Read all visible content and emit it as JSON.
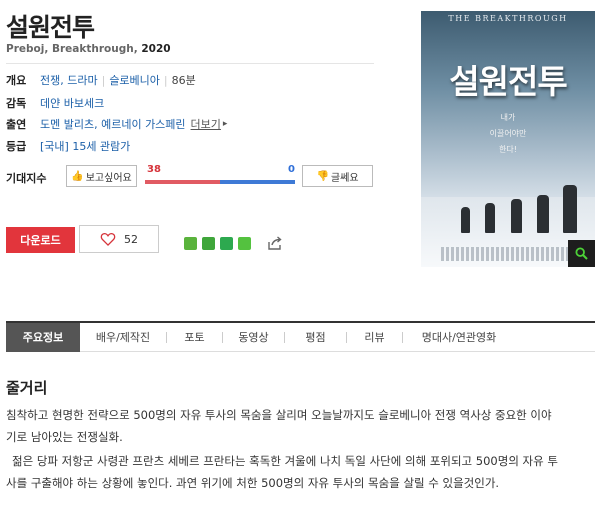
{
  "movie": {
    "title": "설원전투",
    "original_title": "Preboj, Breakthrough,",
    "year": "2020"
  },
  "info": {
    "overview": {
      "label": "개요",
      "genre": "전쟁, 드라마",
      "country": "슬로베니아",
      "runtime": "86분"
    },
    "director": {
      "label": "감독",
      "value": "데얀 바보세크"
    },
    "cast": {
      "label": "출연",
      "value": "도멘 발리츠, 예르네이 가스페린",
      "more": "더보기"
    },
    "rating": {
      "label": "등급",
      "value": "[국내] 15세 관람가"
    }
  },
  "expectation": {
    "label": "기대지수",
    "want_label": "보고싶어요",
    "want_count": "38",
    "notwant_label": "글쎄요",
    "notwant_count": "0",
    "want_ratio": 0.5
  },
  "actions": {
    "download_label": "다운로드",
    "like_count": "52"
  },
  "sns": [
    {
      "name": "blog-icon",
      "color": "#5ab33c"
    },
    {
      "name": "cafe-icon",
      "color": "#3fa63a"
    },
    {
      "name": "bookmark-icon",
      "color": "#2da94f"
    },
    {
      "name": "band-icon",
      "color": "#54c23f"
    }
  ],
  "poster": {
    "english_title": "THE BREAKTHROUGH",
    "korean_title": "설원전투",
    "tagline_1": "내가",
    "tagline_2": "이끌어야만",
    "tagline_3": "한다!"
  },
  "tabs": [
    {
      "label": "주요정보",
      "active": true
    },
    {
      "label": "배우/제작진"
    },
    {
      "label": "포토"
    },
    {
      "label": "동영상"
    },
    {
      "label": "평점"
    },
    {
      "label": "리뷰"
    },
    {
      "label": "명대사/연관영화"
    }
  ],
  "synopsis": {
    "heading": "줄거리",
    "line_1": "침착하고 현명한 전략으로 500명의 자유 투사의 목숨을 살리며 오늘날까지도 슬로베니아 전쟁 역사상 중요한 이야",
    "line_2": "기로 남아있는 전쟁실화.",
    "line_3": "젊은 당파 저항군 사령관 프란츠 세베르 프란타는 혹독한 겨울에 나치 독일 사단에 의해 포위되고 500명의 자유 투",
    "line_4": "사를 구출해야 하는 상황에 놓인다. 과연 위기에 처한 500명의 자유 투사의 목숨을 살릴 수 있을것인가."
  },
  "colors": {
    "accent_red": "#e2353c",
    "link_blue": "#1b5fa8",
    "bar_blue": "#3e7ad6",
    "bar_red": "#e15b63"
  }
}
